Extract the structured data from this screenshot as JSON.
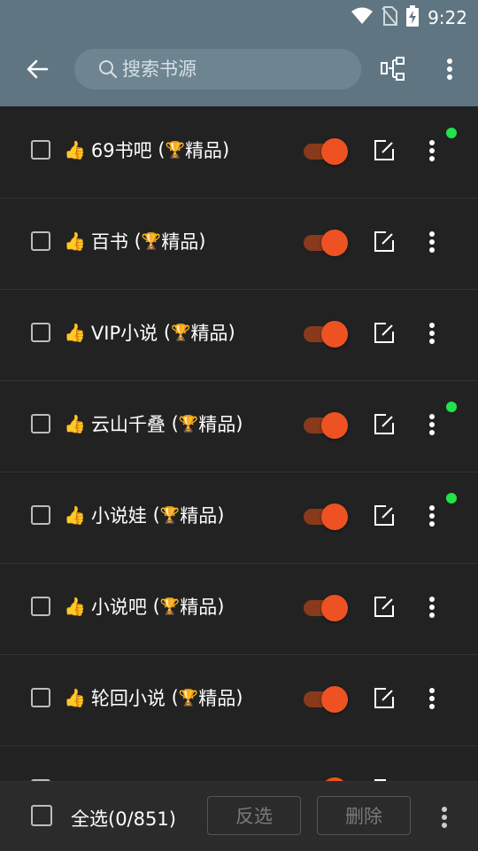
{
  "status_bar": {
    "time": "9:22"
  },
  "app_bar": {
    "search_placeholder": "搜索书源"
  },
  "sources": [
    {
      "name": "69书吧",
      "badge_text": "精品",
      "enabled": true,
      "has_dot": true
    },
    {
      "name": "百书",
      "badge_text": "精品",
      "enabled": true,
      "has_dot": false
    },
    {
      "name": "VIP小说",
      "badge_text": "精品",
      "enabled": true,
      "has_dot": false
    },
    {
      "name": "云山千叠",
      "badge_text": "精品",
      "enabled": true,
      "has_dot": true
    },
    {
      "name": "小说娃",
      "badge_text": "精品",
      "enabled": true,
      "has_dot": true
    },
    {
      "name": "小说吧",
      "badge_text": "精品",
      "enabled": true,
      "has_dot": false
    },
    {
      "name": "轮回小说",
      "badge_text": "精品",
      "enabled": true,
      "has_dot": false
    }
  ],
  "bottom_bar": {
    "select_all_label": "全选(0/851)",
    "invert_label": "反选",
    "delete_label": "删除"
  },
  "colors": {
    "accent": "#ee5222",
    "topbar": "#5f7582",
    "dot": "#22e34a"
  }
}
